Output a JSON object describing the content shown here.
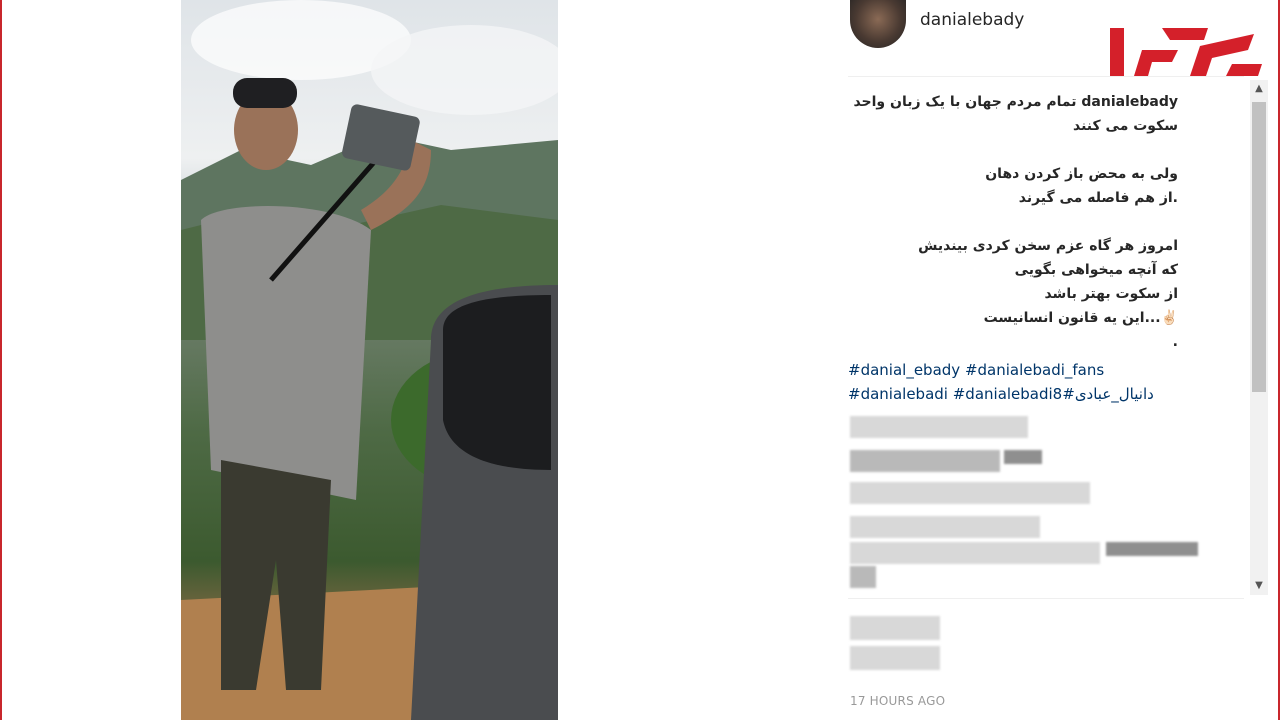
{
  "post": {
    "username": "danialebady",
    "caption_user": "danialebady",
    "caption_lines": [
      "تمام مردم جهان با یک زبان واحد",
      "سکوت می کنند",
      "",
      "ولی به محض باز کردن دهان",
      ".از هم فاصله می گیرند",
      "",
      "امروز هر گاه عزم سخن کردی بیندیش",
      "که آنچه میخواهی بگویی",
      "از سکوت بهتر باشد",
      "✌🏻...این یه قانون انسانیست",
      "."
    ],
    "hashtags_line1": [
      "#danial_ebady",
      "#danialebadi_fans"
    ],
    "hashtags_line2": [
      "#danialebadi",
      "#danialebadi8",
      "#دانیال_عبادی"
    ],
    "timestamp": "17 HOURS AGO"
  },
  "logo": {
    "label": "رکنا",
    "color": "#d4202a"
  },
  "icons": {
    "scroll_up": "scroll-up-arrow-icon",
    "scroll_down": "scroll-down-arrow-icon"
  },
  "colors": {
    "frame": "#c8262c",
    "hashtag": "#003569",
    "timestamp": "#999999"
  }
}
